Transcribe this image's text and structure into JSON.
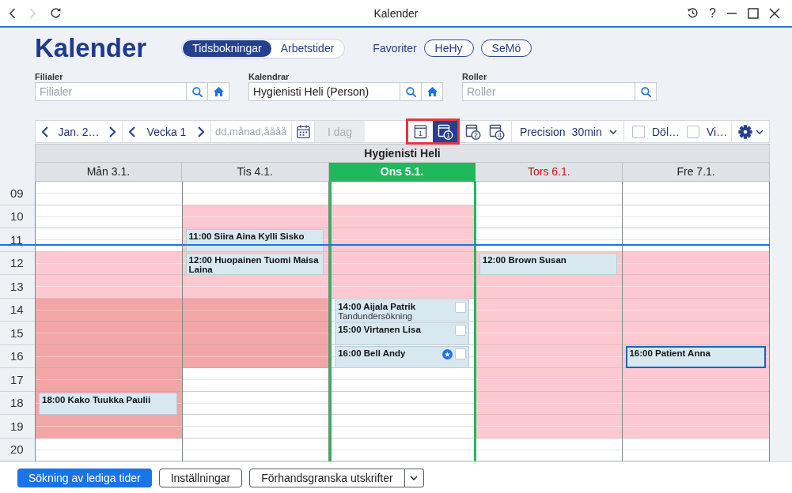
{
  "window": {
    "title": "Kalender",
    "help": "?",
    "nav": [
      {
        "kind": "back",
        "disabled": false
      },
      {
        "kind": "forward",
        "disabled": true
      },
      {
        "kind": "reload",
        "disabled": false
      }
    ]
  },
  "header": {
    "title": "Kalender",
    "modes": [
      {
        "label": "Tidsbokningar",
        "selected": true
      },
      {
        "label": "Arbetstider",
        "selected": false
      }
    ],
    "favorites_label": "Favoriter",
    "favorites": [
      "HeHy",
      "SeMö"
    ]
  },
  "filters": [
    {
      "label": "Filialer",
      "placeholder": "Filialer",
      "kind": "home"
    },
    {
      "label": "Kalendrar",
      "value": "Hygienisti Heli (Person)",
      "kind": "home"
    },
    {
      "label": "Roller",
      "placeholder": "Roller",
      "kind": "search"
    }
  ],
  "toolbar": {
    "month": "Jan. 2…",
    "week": "Vecka 1",
    "date_placeholder": "dd,månad,åååå",
    "today": {
      "label": "I dag",
      "disabled": true
    },
    "views": [
      {
        "kind": "page",
        "number": "1",
        "selected": false,
        "highlighted": true
      },
      {
        "kind": "badge",
        "number": "1",
        "selected": true,
        "highlighted": true
      },
      {
        "kind": "badge",
        "number": "2",
        "selected": false,
        "highlighted": false
      },
      {
        "kind": "badge",
        "number": "4",
        "selected": false,
        "highlighted": false
      }
    ],
    "precision": {
      "label": "Precision",
      "value": "30min"
    },
    "options": [
      {
        "label": "Döl…",
        "checked": false
      },
      {
        "label": "Vi…",
        "checked": false
      }
    ]
  },
  "calendar": {
    "resource": "Hygienisti Heli",
    "hours": [
      {
        "label": "09",
        "now": false
      },
      {
        "label": "10",
        "now": false
      },
      {
        "label": "11",
        "now": true
      },
      {
        "label": "12",
        "now": false
      },
      {
        "label": "13",
        "now": false
      },
      {
        "label": "14",
        "now": false
      },
      {
        "label": "15",
        "now": false
      },
      {
        "label": "16",
        "now": false
      },
      {
        "label": "17",
        "now": false
      },
      {
        "label": "18",
        "now": false
      },
      {
        "label": "19",
        "now": false
      },
      {
        "label": "20",
        "now": false
      }
    ],
    "days": [
      {
        "label": "Mån 3.1.",
        "today": false,
        "holiday": false,
        "slots": [
          {
            "available": true,
            "blocked": false
          },
          {
            "available": true,
            "blocked": false
          },
          {
            "available": true,
            "blocked": false
          },
          {
            "available": false,
            "blocked": false
          },
          {
            "available": false,
            "blocked": false
          },
          {
            "available": false,
            "blocked": true
          },
          {
            "available": false,
            "blocked": true
          },
          {
            "available": false,
            "blocked": true
          },
          {
            "available": false,
            "blocked": true
          },
          {
            "available": false,
            "blocked": true,
            "appointment": {
              "kind": "booking",
              "title": "18:00 Kako Tuukka Paulii",
              "selected": false,
              "starred": false
            }
          },
          {
            "available": false,
            "blocked": true
          },
          {
            "available": true,
            "blocked": false
          }
        ]
      },
      {
        "label": "Tis 4.1.",
        "today": false,
        "holiday": false,
        "slots": [
          {
            "available": true,
            "blocked": false
          },
          {
            "available": false,
            "blocked": false
          },
          {
            "available": false,
            "blocked": false,
            "appointment": {
              "kind": "booking",
              "title": "11:00 Siira Aina Kylli Sisko",
              "selected": false,
              "starred": false
            }
          },
          {
            "available": false,
            "blocked": false,
            "appointment": {
              "kind": "booking",
              "title": "12:00 Huopainen Tuomi Maisa Laina",
              "selected": false,
              "starred": false
            }
          },
          {
            "available": false,
            "blocked": false
          },
          {
            "available": false,
            "blocked": true
          },
          {
            "available": false,
            "blocked": true
          },
          {
            "available": false,
            "blocked": true
          },
          {
            "available": true,
            "blocked": false
          },
          {
            "available": true,
            "blocked": false
          },
          {
            "available": true,
            "blocked": false
          },
          {
            "available": true,
            "blocked": false
          }
        ]
      },
      {
        "label": "Ons 5.1.",
        "today": true,
        "holiday": false,
        "slots": [
          {
            "available": true,
            "blocked": false
          },
          {
            "available": false,
            "blocked": false
          },
          {
            "available": false,
            "blocked": false
          },
          {
            "available": false,
            "blocked": false
          },
          {
            "available": false,
            "blocked": false
          },
          {
            "available": true,
            "blocked": false,
            "appointment": {
              "kind": "task",
              "title": "14:00 Aijala Patrik",
              "note": "Tandundersökning",
              "selected": false,
              "starred": false,
              "checked": false
            }
          },
          {
            "available": true,
            "blocked": false,
            "appointment": {
              "kind": "task",
              "title": "15:00 Virtanen Lisa",
              "selected": false,
              "starred": false,
              "checked": false
            }
          },
          {
            "available": true,
            "blocked": false,
            "appointment": {
              "kind": "task",
              "title": "16:00 Bell Andy",
              "selected": false,
              "starred": true,
              "checked": false
            }
          },
          {
            "available": true,
            "blocked": false
          },
          {
            "available": true,
            "blocked": false
          },
          {
            "available": true,
            "blocked": false
          },
          {
            "available": true,
            "blocked": false
          }
        ]
      },
      {
        "label": "Tors 6.1.",
        "today": false,
        "holiday": true,
        "slots": [
          {
            "available": true,
            "blocked": false
          },
          {
            "available": true,
            "blocked": false
          },
          {
            "available": true,
            "blocked": false
          },
          {
            "available": false,
            "blocked": false,
            "appointment": {
              "kind": "booking",
              "title": "12:00 Brown Susan",
              "selected": false,
              "starred": false
            }
          },
          {
            "available": false,
            "blocked": false
          },
          {
            "available": false,
            "blocked": false
          },
          {
            "available": false,
            "blocked": false
          },
          {
            "available": false,
            "blocked": false
          },
          {
            "available": false,
            "blocked": false
          },
          {
            "available": false,
            "blocked": false
          },
          {
            "available": false,
            "blocked": false
          },
          {
            "available": true,
            "blocked": false
          }
        ]
      },
      {
        "label": "Fre 7.1.",
        "today": false,
        "holiday": false,
        "slots": [
          {
            "available": true,
            "blocked": false
          },
          {
            "available": true,
            "blocked": false
          },
          {
            "available": true,
            "blocked": false
          },
          {
            "available": false,
            "blocked": false
          },
          {
            "available": false,
            "blocked": false
          },
          {
            "available": false,
            "blocked": false
          },
          {
            "available": false,
            "blocked": false
          },
          {
            "available": false,
            "blocked": false,
            "appointment": {
              "kind": "booking",
              "title": "16:00 Patient Anna",
              "selected": true,
              "starred": false
            }
          },
          {
            "available": false,
            "blocked": false
          },
          {
            "available": false,
            "blocked": false
          },
          {
            "available": false,
            "blocked": false
          },
          {
            "available": true,
            "blocked": false
          }
        ]
      }
    ]
  },
  "actions": [
    {
      "kind": "primary",
      "label": "Sökning av lediga tider"
    },
    {
      "kind": "secondary",
      "label": "Inställningar"
    },
    {
      "kind": "split",
      "label": "Förhandsgranska utskrifter"
    }
  ]
}
